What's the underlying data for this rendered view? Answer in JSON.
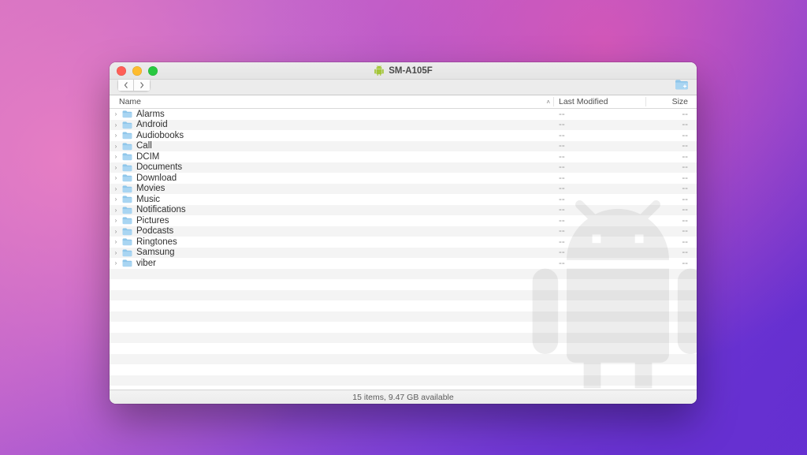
{
  "window": {
    "title": "SM-A105F"
  },
  "columns": {
    "name": "Name",
    "modified": "Last Modified",
    "size": "Size",
    "sort_indicator": "˄"
  },
  "rows": [
    {
      "name": "Alarms",
      "modified": "--",
      "size": "--"
    },
    {
      "name": "Android",
      "modified": "--",
      "size": "--"
    },
    {
      "name": "Audiobooks",
      "modified": "--",
      "size": "--"
    },
    {
      "name": "Call",
      "modified": "--",
      "size": "--"
    },
    {
      "name": "DCIM",
      "modified": "--",
      "size": "--"
    },
    {
      "name": "Documents",
      "modified": "--",
      "size": "--"
    },
    {
      "name": "Download",
      "modified": "--",
      "size": "--"
    },
    {
      "name": "Movies",
      "modified": "--",
      "size": "--"
    },
    {
      "name": "Music",
      "modified": "--",
      "size": "--"
    },
    {
      "name": "Notifications",
      "modified": "--",
      "size": "--"
    },
    {
      "name": "Pictures",
      "modified": "--",
      "size": "--"
    },
    {
      "name": "Podcasts",
      "modified": "--",
      "size": "--"
    },
    {
      "name": "Ringtones",
      "modified": "--",
      "size": "--"
    },
    {
      "name": "Samsung",
      "modified": "--",
      "size": "--"
    },
    {
      "name": "viber",
      "modified": "--",
      "size": "--"
    }
  ],
  "status": "15 items, 9.47 GB available",
  "icons": {
    "disclosure": "›"
  }
}
